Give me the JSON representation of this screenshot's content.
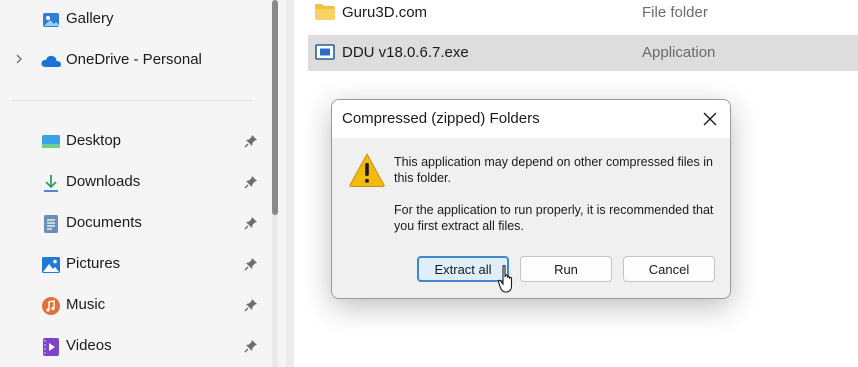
{
  "sidebar": {
    "top_items": [
      {
        "label": "Gallery",
        "icon": "gallery-icon",
        "has_chevron": false
      },
      {
        "label": "OneDrive - Personal",
        "icon": "onedrive-icon",
        "has_chevron": true
      }
    ],
    "quick_access": [
      {
        "label": "Desktop",
        "icon": "desktop-icon",
        "pinned": true
      },
      {
        "label": "Downloads",
        "icon": "download-icon",
        "pinned": true
      },
      {
        "label": "Documents",
        "icon": "documents-icon",
        "pinned": true
      },
      {
        "label": "Pictures",
        "icon": "pictures-icon",
        "pinned": true
      },
      {
        "label": "Music",
        "icon": "music-icon",
        "pinned": true
      },
      {
        "label": "Videos",
        "icon": "videos-icon",
        "pinned": true
      }
    ]
  },
  "files": [
    {
      "name": "Guru3D.com",
      "type": "File folder",
      "icon": "folder-icon",
      "selected": false
    },
    {
      "name": "DDU v18.0.6.7.exe",
      "type": "Application",
      "icon": "application-icon",
      "selected": true
    }
  ],
  "dialog": {
    "title": "Compressed (zipped) Folders",
    "icon": "warning-icon",
    "message_line1": "This application may depend on other compressed files in this folder.",
    "message_line2": "For the application to run properly, it is recommended that you first extract all files.",
    "buttons": {
      "extract_all": "Extract all",
      "run": "Run",
      "cancel": "Cancel"
    }
  },
  "colors": {
    "accent": "#3f88c9",
    "warning": "#f2b90f",
    "folder": "#f4c041",
    "selection": "#dddddd"
  }
}
